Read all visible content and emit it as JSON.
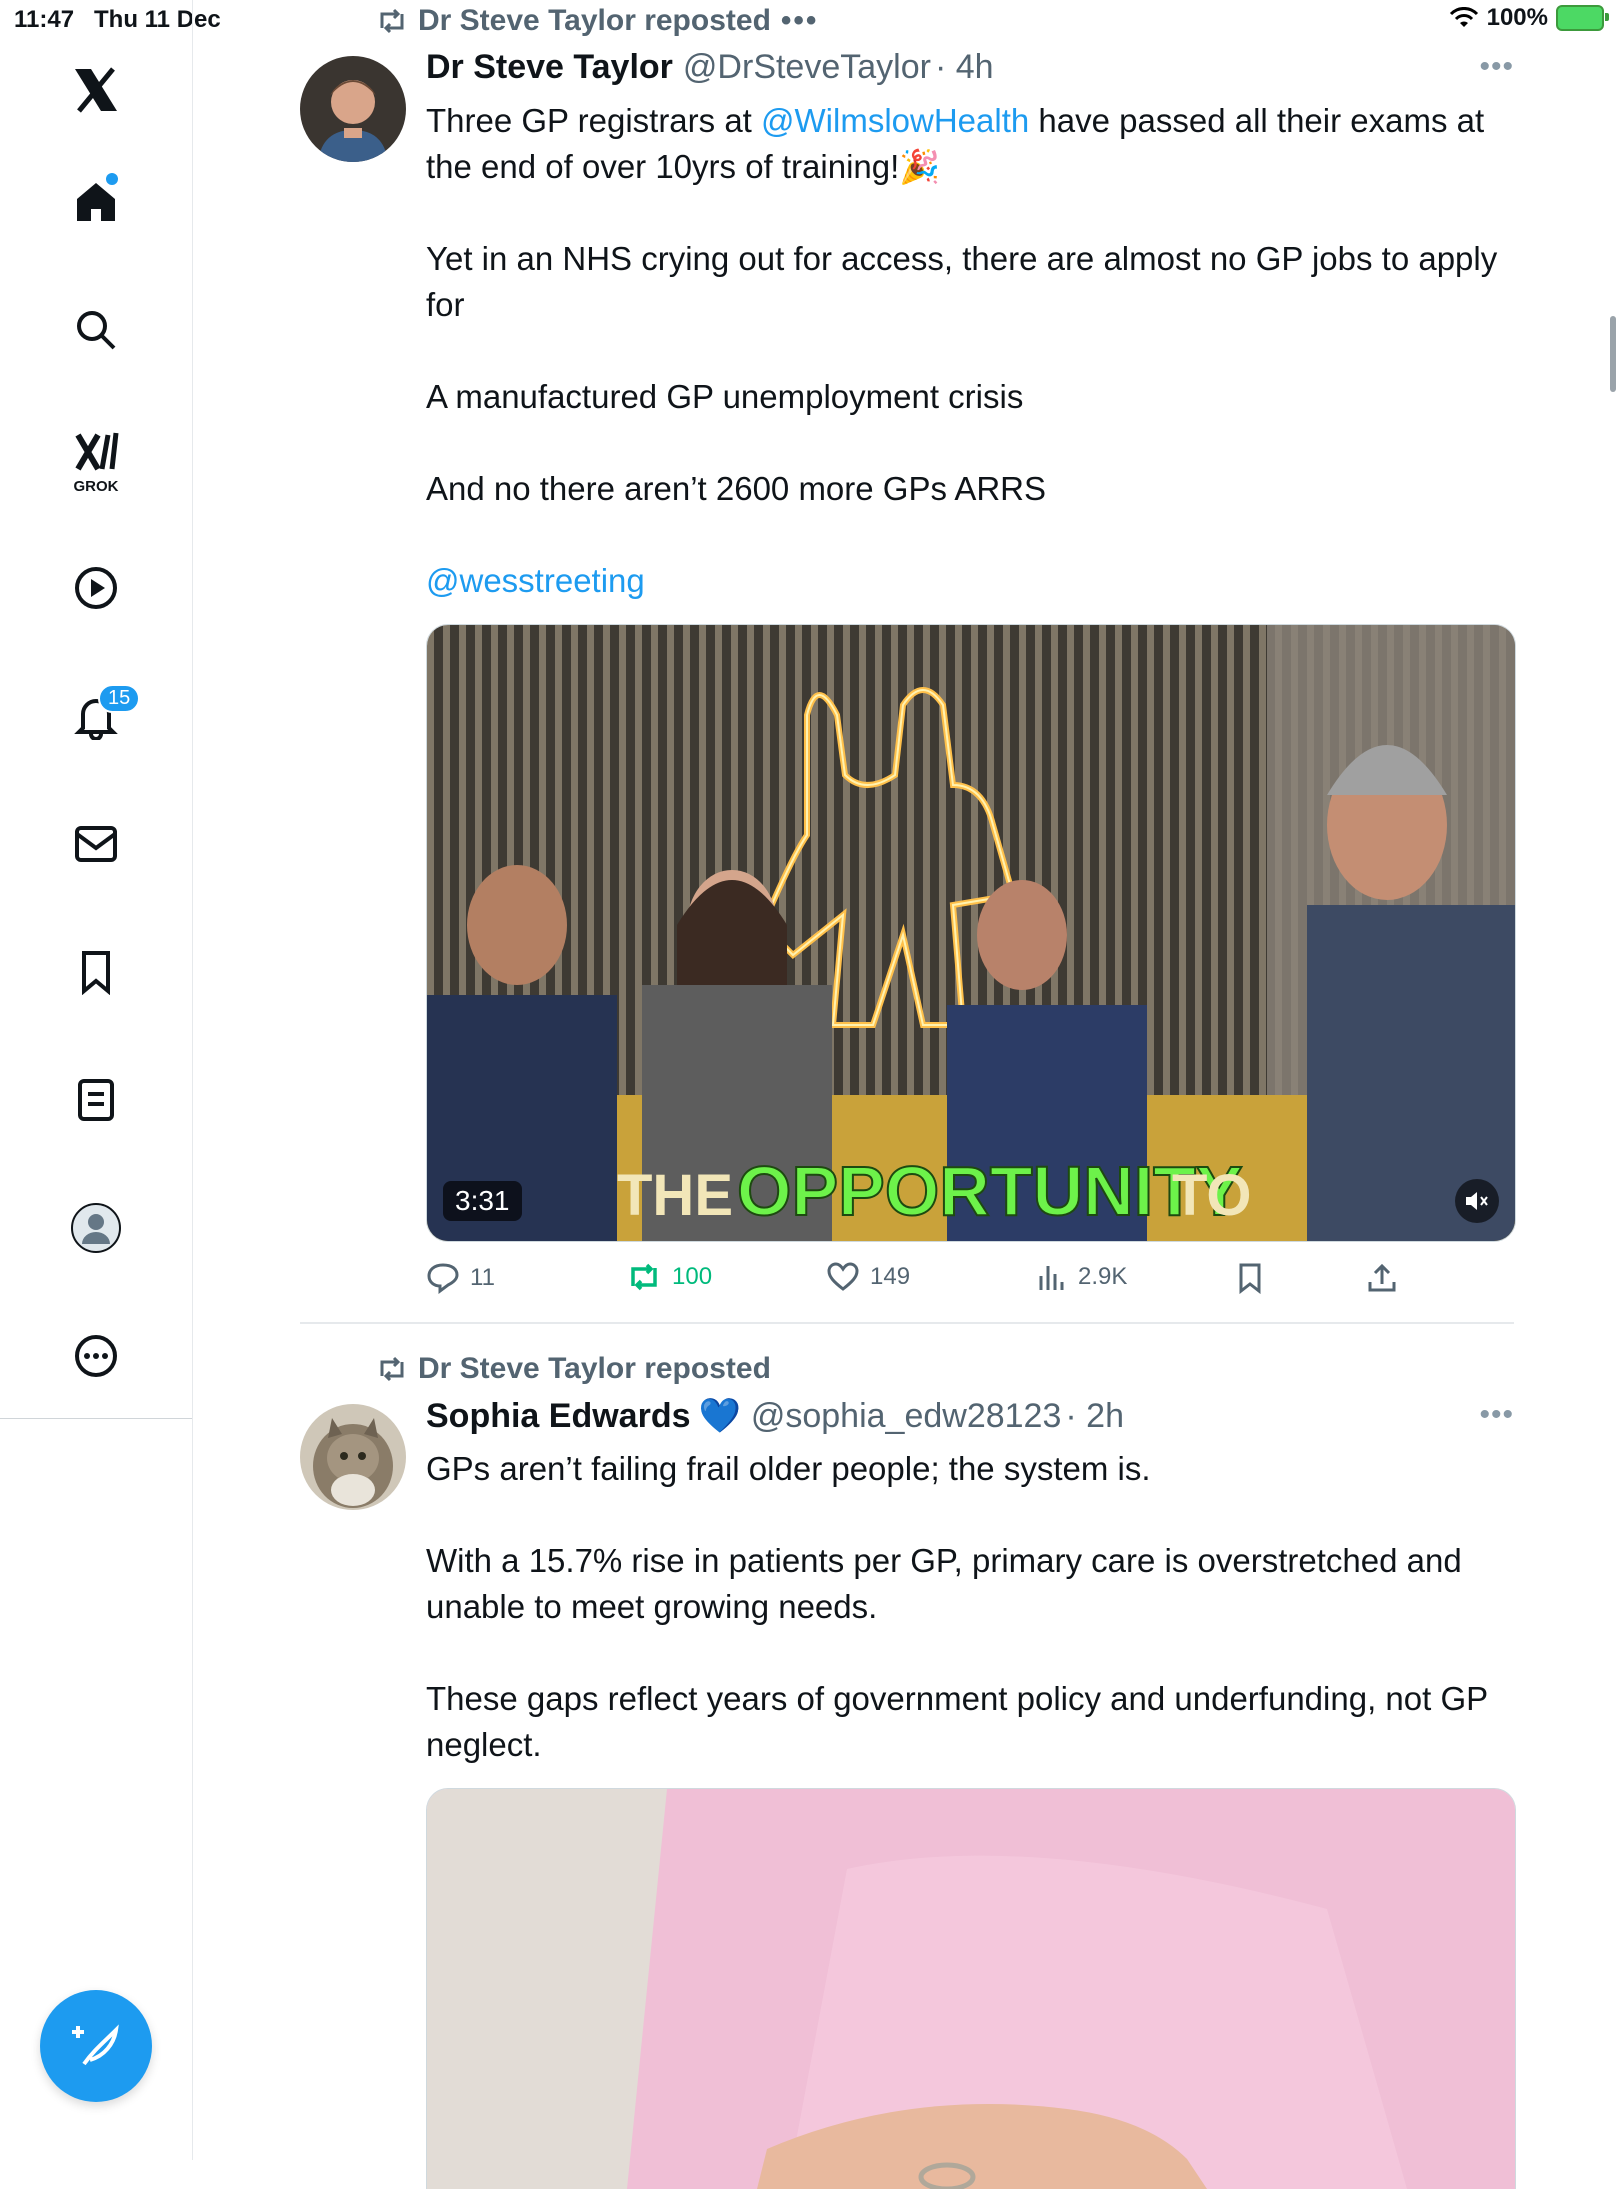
{
  "status": {
    "time": "11:47",
    "date": "Thu 11 Dec",
    "battery": "100%"
  },
  "sidebar": {
    "items": [
      {
        "icon": "x-logo-icon"
      },
      {
        "icon": "home-icon"
      },
      {
        "icon": "search-icon"
      },
      {
        "icon": "grok-icon",
        "label": "GROK"
      },
      {
        "icon": "video-icon"
      },
      {
        "icon": "bell-icon",
        "badge": "15"
      },
      {
        "icon": "mail-icon"
      },
      {
        "icon": "bookmark-icon"
      },
      {
        "icon": "lists-icon"
      },
      {
        "icon": "profile-icon"
      },
      {
        "icon": "more-icon"
      }
    ],
    "compose_icon": "compose-icon"
  },
  "posts": [
    {
      "repost": "Dr Steve Taylor reposted",
      "name": "Dr Steve Taylor",
      "handle": "@DrSteveTaylor",
      "time": "· 4h",
      "body": {
        "l1a": "Three GP registrars at ",
        "l1link": "@WilmslowHealth",
        "l1b": " have passed all their exams at the end of over 10yrs of training!🎉",
        "p2": "Yet in an NHS crying out for access, there are almost no GP jobs to apply for",
        "p3": "A manufactured GP unemployment crisis",
        "p4": "And no there aren’t 2600 more GPs ARRS",
        "p5link": "@wesstreeting"
      },
      "video": {
        "duration": "3:31",
        "caption_a": "THE ",
        "caption_b": "OPPORTUNITY",
        "caption_c": " TO"
      },
      "stats": {
        "replies": "11",
        "reposts": "100",
        "likes": "149",
        "views": "2.9K"
      }
    },
    {
      "repost": "Dr Steve Taylor reposted",
      "name": "Sophia Edwards",
      "badge": "💙",
      "handle": "@sophia_edw28123",
      "time": "· 2h",
      "body": {
        "p1": "GPs aren’t failing frail older people; the system is.",
        "p2": "With a 15.7% rise in patients per GP, primary care is overstretched and unable to meet growing needs.",
        "p3": "These gaps reflect years of government policy and underfunding, not GP neglect."
      }
    }
  ],
  "colors": {
    "accent": "#1d9bf0",
    "repost_green": "#00ba7c",
    "muted": "#536471"
  }
}
